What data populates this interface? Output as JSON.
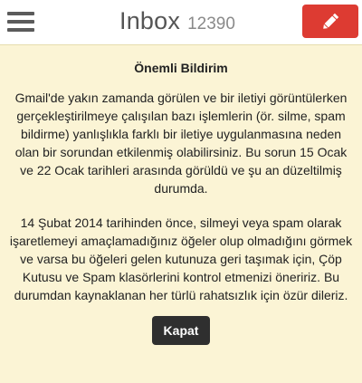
{
  "header": {
    "menu_icon": "hamburger-menu-icon",
    "title": "Inbox",
    "count": "12390",
    "compose_icon": "pencil-icon",
    "compose_color": "#dd3b32"
  },
  "notice": {
    "title": "Önemli Bildirim",
    "paragraph1": "Gmail'de yakın zamanda görülen ve bir iletiyi görüntülerken gerçekleştirilmeye çalışılan bazı işlemlerin (ör. silme, spam bildirme) yanlışlıkla farklı bir iletiye uygulanmasına neden olan bir sorundan etkilenmiş olabilirsiniz. Bu sorun 15 Ocak ve 22 Ocak tarihleri arasında görüldü ve şu an düzeltilmiş durumda.",
    "paragraph2": "14 Şubat 2014 tarihinden önce, silmeyi veya spam olarak işaretlemeyi amaçlamadığınız öğeler olup olmadığını görmek ve varsa bu öğeleri gelen kutunuza geri taşımak için, Çöp Kutusu ve Spam klasörlerini kontrol etmenizi öneririz. Bu durumdan kaynaklanan her türlü rahatsızlık için özür dileriz.",
    "close_label": "Kapat"
  },
  "colors": {
    "notice_background": "#fbf4d5",
    "close_button": "#2f2f2f"
  }
}
